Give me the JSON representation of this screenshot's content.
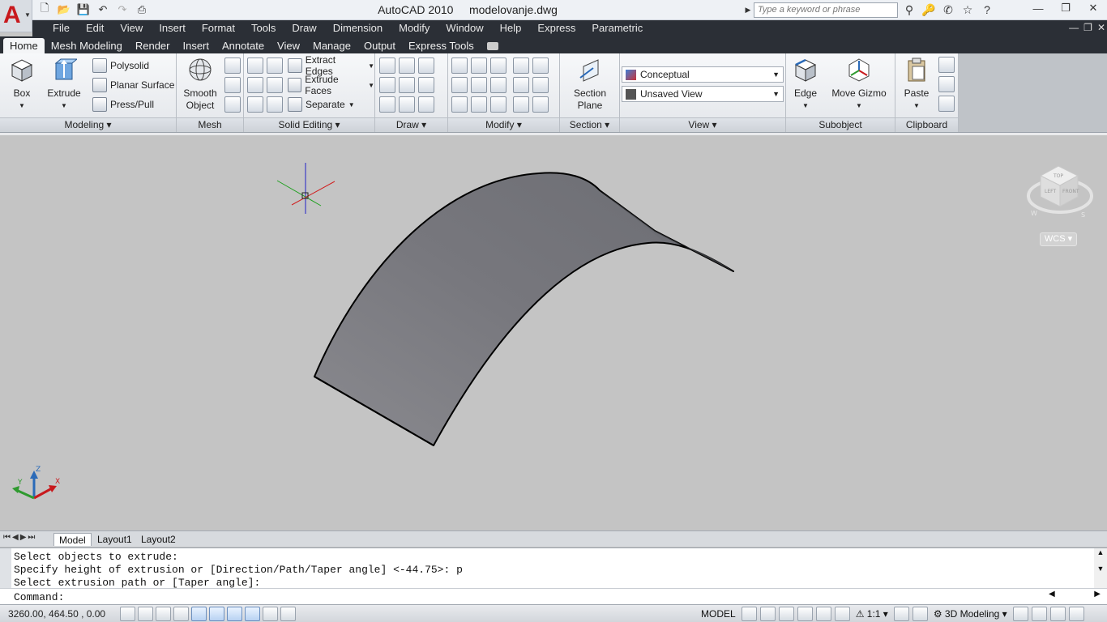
{
  "app": {
    "title": "AutoCAD 2010",
    "document": "modelovanje.dwg",
    "logo_letter": "A",
    "search_placeholder": "Type a keyword or phrase"
  },
  "qat": [
    "new-icon",
    "open-icon",
    "save-icon",
    "undo-icon",
    "redo-icon",
    "plot-icon"
  ],
  "menu": [
    "File",
    "Edit",
    "View",
    "Insert",
    "Format",
    "Tools",
    "Draw",
    "Dimension",
    "Modify",
    "Window",
    "Help",
    "Express",
    "Parametric"
  ],
  "ribbon_tabs": [
    "Home",
    "Mesh Modeling",
    "Render",
    "Insert",
    "Annotate",
    "View",
    "Manage",
    "Output",
    "Express Tools"
  ],
  "active_tab": "Home",
  "panels": {
    "modeling": {
      "title": "Modeling",
      "box": "Box",
      "extrude": "Extrude",
      "polysolid": "Polysolid",
      "planar_surface": "Planar Surface",
      "press_pull": "Press/Pull"
    },
    "mesh": {
      "title": "Mesh",
      "smooth_object_1": "Smooth",
      "smooth_object_2": "Object"
    },
    "solid_editing": {
      "title": "Solid Editing",
      "extract_edges": "Extract Edges",
      "extrude_faces": "Extrude Faces",
      "separate": "Separate"
    },
    "draw": {
      "title": "Draw"
    },
    "modify": {
      "title": "Modify"
    },
    "section": {
      "title": "Section",
      "section_plane_1": "Section",
      "section_plane_2": "Plane"
    },
    "view": {
      "title": "View",
      "visual_style": "Conceptual",
      "named_view": "Unsaved View"
    },
    "subobject": {
      "title": "Subobject",
      "edge": "Edge",
      "move_gizmo": "Move Gizmo"
    },
    "clipboard": {
      "title": "Clipboard",
      "paste": "Paste"
    }
  },
  "viewport": {
    "viewcube": {
      "top": "TOP",
      "left": "LEFT",
      "front": "FRONT",
      "compass_w": "W",
      "compass_s": "S"
    },
    "wcs_label": "WCS",
    "ucs_axes": {
      "x": "X",
      "y": "Y",
      "z": "Z"
    }
  },
  "layout_tabs": [
    "Model",
    "Layout1",
    "Layout2"
  ],
  "active_layout": "Model",
  "command": {
    "history": [
      "Select objects to extrude:",
      "Specify height of extrusion or [Direction/Path/Taper angle] <-44.75>: p",
      "Select extrusion path or [Taper angle]:"
    ],
    "prompt": "Command:"
  },
  "status": {
    "coordinates": "3260.00, 464.50 , 0.00",
    "model_label": "MODEL",
    "annotation_scale": "1:1",
    "workspace": "3D Modeling"
  },
  "colors": {
    "menubar_bg": "#2b2f36",
    "viewport_bg": "#c4c4c4",
    "surface_fill": "#7f8086",
    "autocad_red": "#c8191d"
  }
}
